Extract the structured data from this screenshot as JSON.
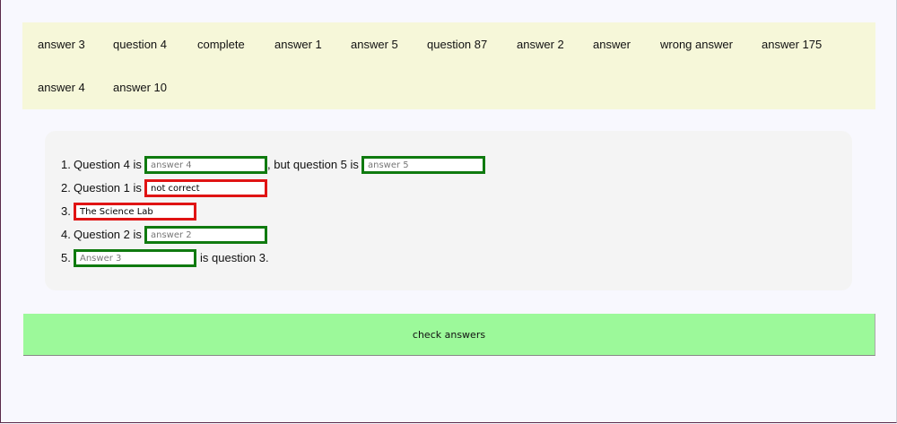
{
  "word_bank": {
    "items": [
      "answer 3",
      "question 4",
      "complete",
      "answer 1",
      "answer 5",
      "question 87",
      "answer 2",
      "answer",
      "wrong answer",
      "answer 175",
      "answer 4",
      "answer 10"
    ]
  },
  "questions": [
    {
      "number": "1.",
      "text": "Question 4 is",
      "answer1_placeholder": "answer 4",
      "mid_text": ", but question 5 is",
      "answer2_placeholder": "answer 5"
    },
    {
      "number": "2.",
      "text": "Question 1 is",
      "answer_value": "not correct"
    },
    {
      "number": "3.",
      "answer_value": "The Science Lab"
    },
    {
      "number": "4.",
      "text": "Question 2 is",
      "answer_placeholder": "answer 2"
    },
    {
      "number": "5.",
      "answer_placeholder": "Answer 3",
      "after_text": "is question 3."
    }
  ],
  "check_button": {
    "label": "check answers"
  },
  "colors": {
    "correct_border": "#0f7a0f",
    "incorrect_border": "#e01414",
    "word_bank_bg": "#f6f7d9",
    "button_bg": "#9cf99a"
  }
}
